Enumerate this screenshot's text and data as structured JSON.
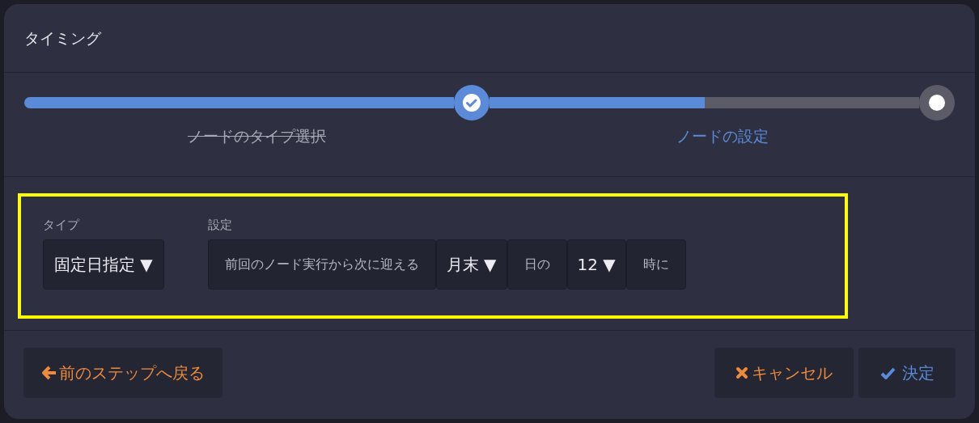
{
  "dialog": {
    "title": "タイミング"
  },
  "stepper": {
    "steps": [
      {
        "label": "ノードのタイプ選択",
        "done": true,
        "selected": false
      },
      {
        "label": "ノードの設定",
        "done": false,
        "selected": true,
        "level": 0.5
      }
    ]
  },
  "form": {
    "highlighted": true,
    "type": {
      "label": "タイプ",
      "value": "固定日指定 ▼"
    },
    "settings": {
      "label": "設定",
      "parts": [
        {
          "kind": "text",
          "text": "前回のノード実行から次に迎える"
        },
        {
          "kind": "select",
          "text": "月末 ▼"
        },
        {
          "kind": "text",
          "text": "日の"
        },
        {
          "kind": "select",
          "text": "12 ▼"
        },
        {
          "kind": "text",
          "text": "時に"
        }
      ]
    }
  },
  "footer": {
    "back": "前のステップへ戻る",
    "cancel": "キャンセル",
    "ok": "決定"
  }
}
